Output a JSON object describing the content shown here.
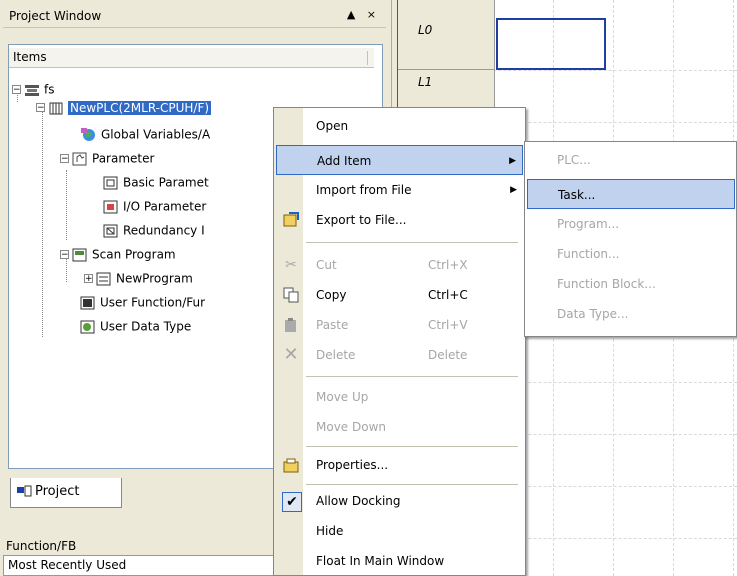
{
  "project_window": {
    "title": "Project Window",
    "title_buttons": "▲ ×",
    "items_header": "Items",
    "tree": {
      "root": "fs",
      "plc": "NewPLC(2MLR-CPUH/F)",
      "global_vars": "Global Variables/A",
      "parameter": "Parameter",
      "basic_param": "Basic Paramet",
      "io_param": "I/O Parameter",
      "redundancy": "Redundancy I",
      "scan_program": "Scan Program",
      "new_program": "NewProgram",
      "user_function": "User Function/Fur",
      "user_data_type": "User Data Type"
    },
    "tab_label": "Project"
  },
  "function_fb": {
    "title": "Function/FB",
    "value": "Most Recently Used"
  },
  "ladder": {
    "rows": [
      "L0",
      "L1"
    ]
  },
  "context_menu": {
    "items": [
      {
        "label": "Open",
        "shortcut": ""
      },
      {
        "label": "Add Item",
        "shortcut": ""
      },
      {
        "label": "Import from File",
        "shortcut": ""
      },
      {
        "label": "Export to File...",
        "shortcut": ""
      },
      {
        "label": "Cut",
        "shortcut": "Ctrl+X"
      },
      {
        "label": "Copy",
        "shortcut": "Ctrl+C"
      },
      {
        "label": "Paste",
        "shortcut": "Ctrl+V"
      },
      {
        "label": "Delete",
        "shortcut": "Delete"
      },
      {
        "label": "Move Up",
        "shortcut": ""
      },
      {
        "label": "Move Down",
        "shortcut": ""
      },
      {
        "label": "Properties...",
        "shortcut": ""
      },
      {
        "label": "Allow Docking",
        "shortcut": ""
      },
      {
        "label": "Hide",
        "shortcut": ""
      },
      {
        "label": "Float In Main Window",
        "shortcut": ""
      }
    ]
  },
  "submenu": {
    "items": [
      {
        "label": "PLC..."
      },
      {
        "label": "Task..."
      },
      {
        "label": "Program..."
      },
      {
        "label": "Function..."
      },
      {
        "label": "Function Block..."
      },
      {
        "label": "Data Type..."
      }
    ]
  },
  "colors": {
    "selection_blue": "#316ac5",
    "menu_highlight": "#c1d2ee",
    "window_bg": "#ece9d8"
  }
}
